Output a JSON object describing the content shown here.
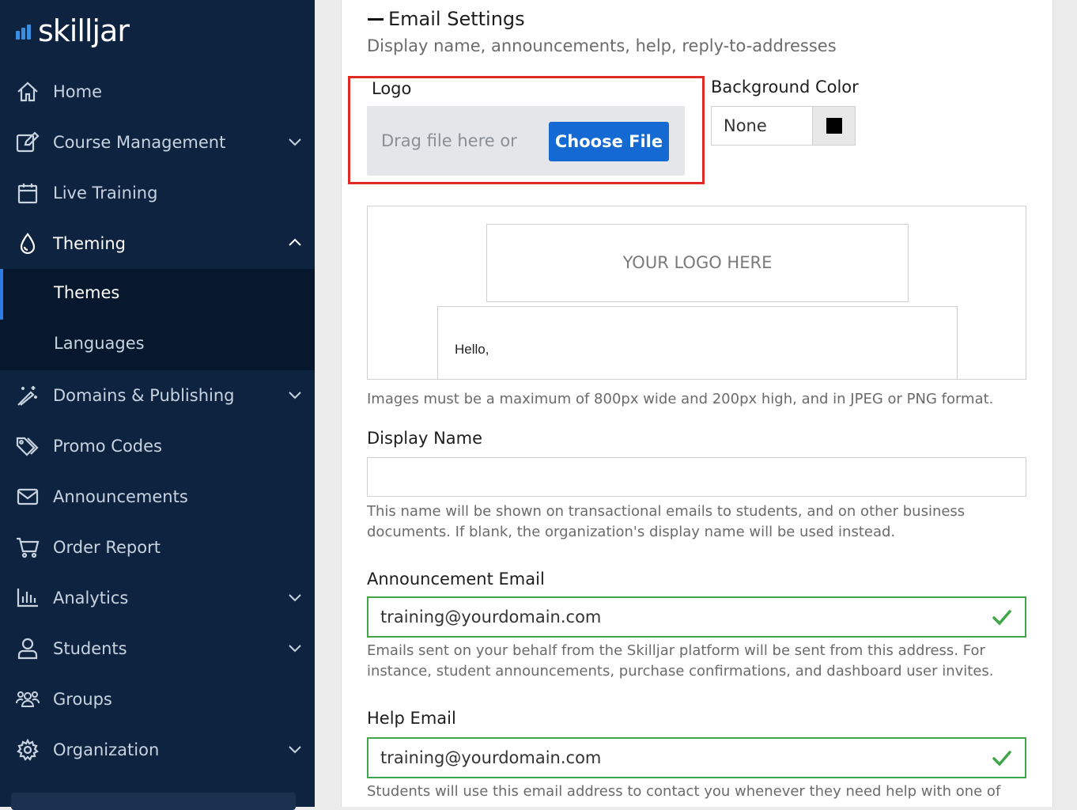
{
  "brand": {
    "name": "skilljar",
    "accent": "#3a8de0"
  },
  "sidebar": {
    "items": [
      {
        "label": "Home",
        "icon": "home-icon"
      },
      {
        "label": "Course Management",
        "icon": "edit-icon",
        "expandable": true
      },
      {
        "label": "Live Training",
        "icon": "calendar-icon"
      },
      {
        "label": "Theming",
        "icon": "droplet-icon",
        "expanded": true
      },
      {
        "label": "Domains & Publishing",
        "icon": "magic-wand-icon",
        "expandable": true
      },
      {
        "label": "Promo Codes",
        "icon": "tags-icon"
      },
      {
        "label": "Announcements",
        "icon": "envelope-icon"
      },
      {
        "label": "Order Report",
        "icon": "cart-icon"
      },
      {
        "label": "Analytics",
        "icon": "bar-chart-icon",
        "expandable": true
      },
      {
        "label": "Students",
        "icon": "user-icon",
        "expandable": true
      },
      {
        "label": "Groups",
        "icon": "users-icon"
      },
      {
        "label": "Organization",
        "icon": "gear-icon",
        "expandable": true
      }
    ],
    "theming_sub": [
      {
        "label": "Themes",
        "selected": true
      },
      {
        "label": "Languages",
        "selected": false
      }
    ]
  },
  "email_settings": {
    "title": "Email Settings",
    "subtitle": "Display name, announcements, help, reply-to-addresses",
    "logo": {
      "label": "Logo",
      "drop_text": "Drag file here or",
      "button_label": "Choose File"
    },
    "background_color": {
      "label": "Background Color",
      "value": "None",
      "swatch": "#000000"
    },
    "preview": {
      "logo_placeholder": "YOUR LOGO HERE",
      "greeting": "Hello,"
    },
    "image_help": "Images must be a maximum of 800px wide and 200px high, and in JPEG or PNG format.",
    "display_name": {
      "label": "Display Name",
      "value": "",
      "help": "This name will be shown on transactional emails to students, and on other business documents. If blank, the organization's display name will be used instead."
    },
    "announcement_email": {
      "label": "Announcement Email",
      "value": "training@yourdomain.com",
      "help": "Emails sent on your behalf from the Skilljar platform will be sent from this address. For instance, student announcements, purchase confirmations, and dashboard user invites."
    },
    "help_email": {
      "label": "Help Email",
      "value": "training@yourdomain.com",
      "help": "Students will use this email address to contact you whenever they need help with one of your"
    }
  },
  "colors": {
    "sidebar_bg": "#0e2340",
    "primary_button": "#1469d2",
    "highlight": "#e02a24",
    "valid": "#3fa64a"
  }
}
